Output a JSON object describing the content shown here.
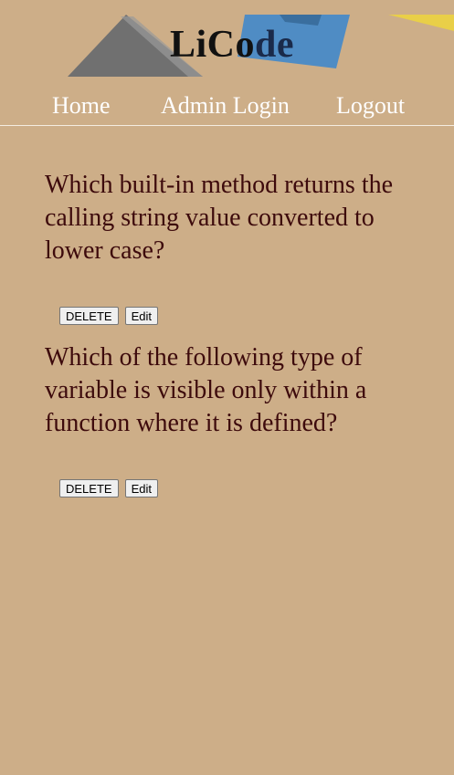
{
  "header": {
    "logo_text_main": "LiCo",
    "logo_text_accent": "de"
  },
  "nav": {
    "items": [
      {
        "label": "Home"
      },
      {
        "label": "Admin Login"
      },
      {
        "label": "Logout"
      }
    ]
  },
  "questions": [
    {
      "text": "Which built-in method returns the calling string value converted to lower case?",
      "delete_label": "DELETE",
      "edit_label": "Edit"
    },
    {
      "text": "Which of the following type of variable is visible only within a function where it is defined?",
      "delete_label": "DELETE",
      "edit_label": "Edit"
    }
  ],
  "colors": {
    "background": "#cdae88",
    "question_text": "#3d0a0c",
    "nav_text": "#ffffff"
  }
}
